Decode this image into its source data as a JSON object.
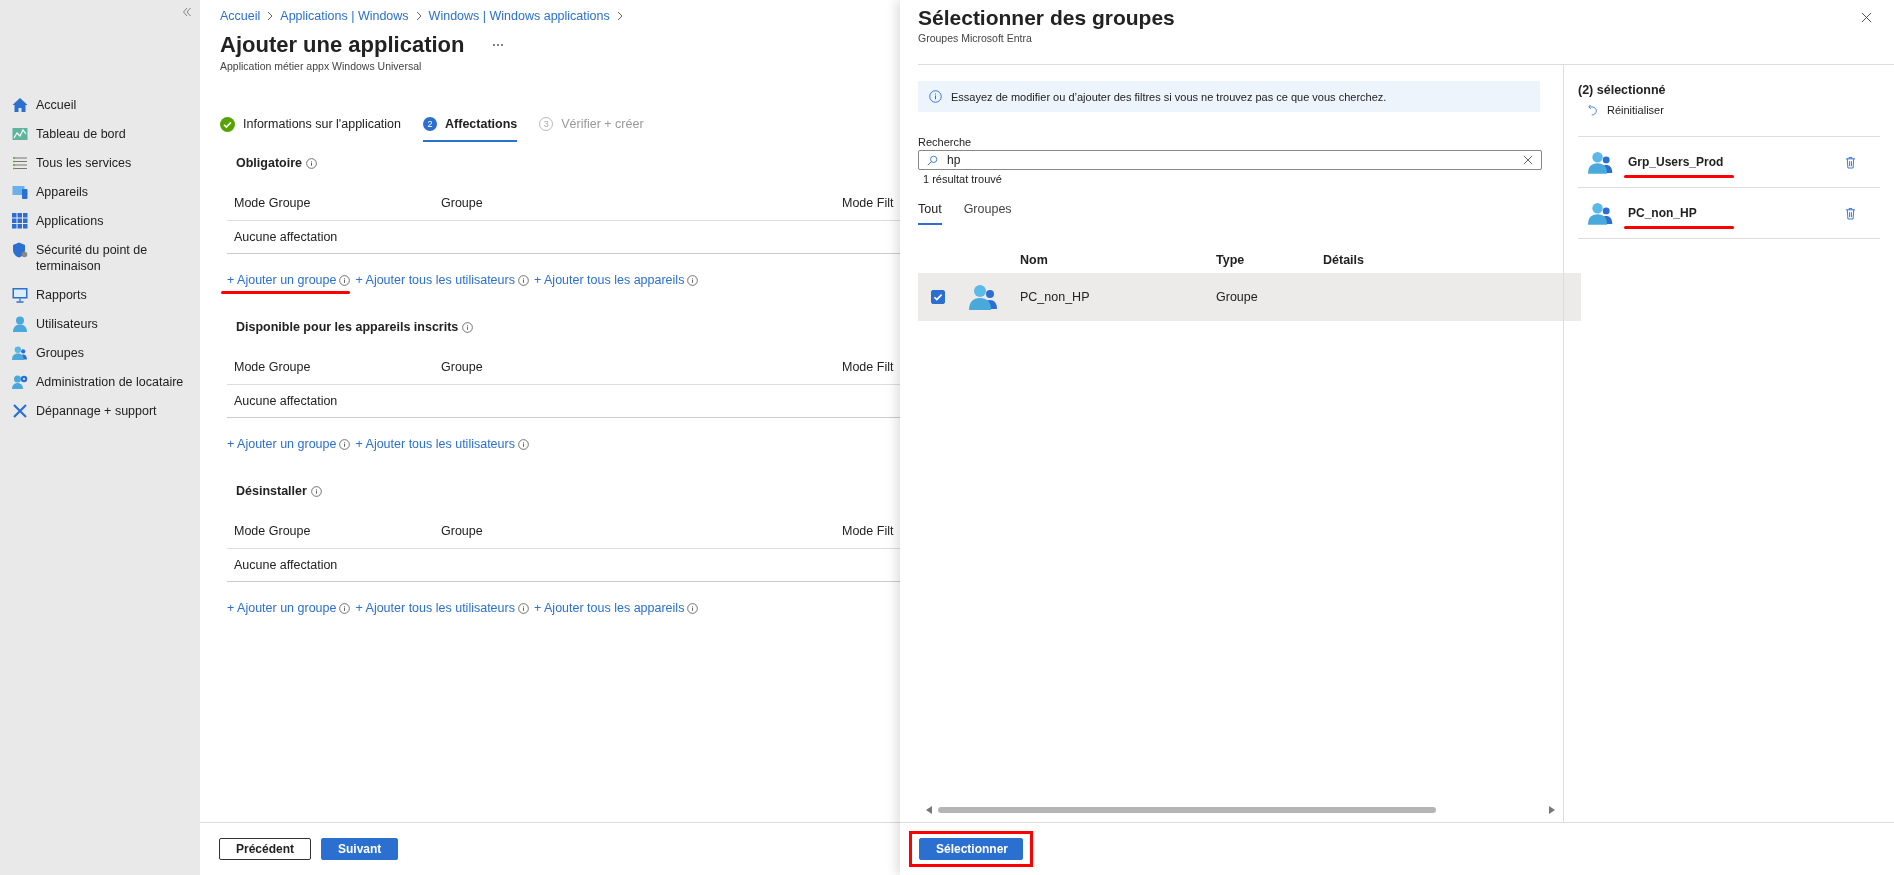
{
  "sidebar": {
    "items": [
      {
        "label": "Accueil"
      },
      {
        "label": "Tableau de bord"
      },
      {
        "label": "Tous les services"
      },
      {
        "label": "Appareils"
      },
      {
        "label": "Applications"
      },
      {
        "label": "Sécurité du point de terminaison"
      },
      {
        "label": "Rapports"
      },
      {
        "label": "Utilisateurs"
      },
      {
        "label": "Groupes"
      },
      {
        "label": "Administration de locataire"
      },
      {
        "label": "Dépannage + support"
      }
    ]
  },
  "breadcrumb": [
    "Accueil",
    "Applications | Windows",
    "Windows | Windows applications"
  ],
  "page": {
    "title": "Ajouter une application",
    "subtitle": "Application métier appx Windows Universal"
  },
  "steps": [
    {
      "label": "Informations sur l'application",
      "completed": true,
      "disabled": false,
      "selected": false
    },
    {
      "number": "2",
      "label": "Affectations",
      "completed": false,
      "disabled": false,
      "selected": true
    },
    {
      "number": "3",
      "label": "Vérifier + créer",
      "completed": false,
      "disabled": true,
      "selected": false
    }
  ],
  "sections": [
    {
      "title": "Obligatoire",
      "columns": [
        "Mode Groupe",
        "Groupe",
        "Mode Filt"
      ],
      "empty_text": "Aucune affectation",
      "links": [
        {
          "label": "+ Ajouter un groupe",
          "highlighted": true
        },
        {
          "label": "+ Ajouter tous les utilisateurs",
          "highlighted": false
        },
        {
          "label": "+ Ajouter tous les appareils",
          "highlighted": false
        }
      ]
    },
    {
      "title": "Disponible pour les appareils inscrits",
      "columns": [
        "Mode Groupe",
        "Groupe",
        "Mode Filt"
      ],
      "empty_text": "Aucune affectation",
      "links": [
        {
          "label": "+ Ajouter un groupe",
          "highlighted": false
        },
        {
          "label": "+ Ajouter tous les utilisateurs",
          "highlighted": false
        }
      ]
    },
    {
      "title": "Désinstaller",
      "columns": [
        "Mode Groupe",
        "Groupe",
        "Mode Filt"
      ],
      "empty_text": "Aucune affectation",
      "links": [
        {
          "label": "+ Ajouter un groupe",
          "highlighted": false
        },
        {
          "label": "+ Ajouter tous les utilisateurs",
          "highlighted": false
        },
        {
          "label": "+ Ajouter tous les appareils",
          "highlighted": false
        }
      ]
    }
  ],
  "footer": {
    "buttons": [
      {
        "label": "Précédent",
        "kind": "secondary"
      },
      {
        "label": "Suivant",
        "kind": "primary"
      }
    ]
  },
  "panel": {
    "title": "Sélectionner des groupes",
    "subtitle": "Groupes Microsoft Entra",
    "info": "Essayez de modifier ou d’ajouter des filtres si vous ne trouvez pas ce que vous cherchez.",
    "search": {
      "label": "Recherche",
      "value": "hp"
    },
    "result_count": "1 résultat trouvé",
    "tabs": [
      {
        "label": "Tout",
        "selected": true
      },
      {
        "label": "Groupes",
        "selected": false
      }
    ],
    "columns": [
      "Nom",
      "Type",
      "Détails"
    ],
    "rows": [
      {
        "name": "PC_non_HP",
        "type": "Groupe",
        "checked": true,
        "selected": true
      }
    ],
    "selected_pane": {
      "heading": "(2) sélectionné",
      "reset": "Réinitialiser",
      "items": [
        {
          "name": "Grp_Users_Prod",
          "highlighted": true
        },
        {
          "name": "PC_non_HP",
          "highlighted": true
        }
      ]
    },
    "select_button": {
      "label": "Sélectionner",
      "highlighted": true
    }
  }
}
